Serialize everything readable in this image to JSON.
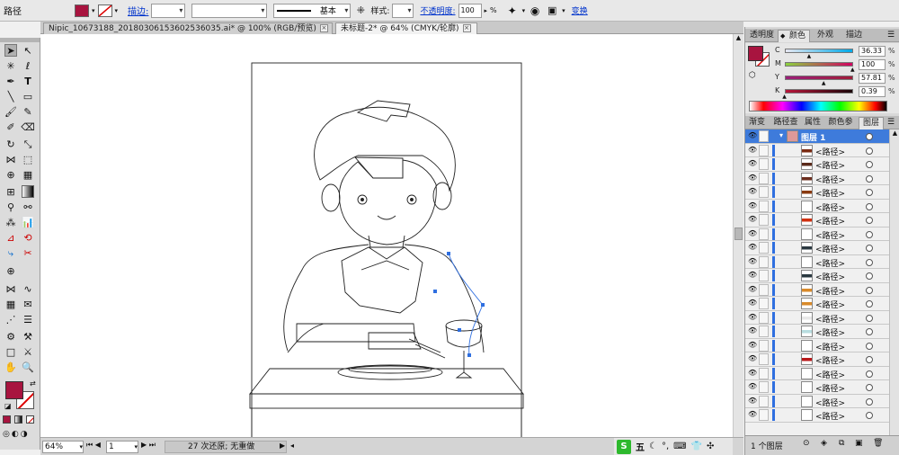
{
  "control_bar": {
    "object_type": "路径",
    "fill_color": "#a8143f",
    "stroke_label": "描边:",
    "stroke_weight": "",
    "brush_field": "",
    "stroke_profile": "基本",
    "style_label": "样式:",
    "opacity_label": "不透明度:",
    "opacity_value": "100",
    "opacity_unit": "%",
    "transform_label": "变换"
  },
  "doc_tabs": [
    {
      "title": "Nipic_10673188_20180306153602536035.ai* @ 100% (RGB/预览)",
      "active": false
    },
    {
      "title": "未标题-2* @ 64% (CMYK/轮廓)",
      "active": true
    }
  ],
  "status_bar": {
    "zoom": "64%",
    "artboard": "1",
    "history": "27 次还原; 无重做"
  },
  "ime_bar": {
    "mode": "五"
  },
  "color_panel": {
    "tabs": [
      "透明度",
      "颜色",
      "外观",
      "描边"
    ],
    "active_tab": "颜色",
    "fill_color": "#a8143f",
    "channels": [
      {
        "label": "C",
        "value": "36.33",
        "unit": "%",
        "gradient": "linear-gradient(90deg,#e6e6f0,#00a9e8)"
      },
      {
        "label": "M",
        "value": "100",
        "unit": "%",
        "gradient": "linear-gradient(90deg,#8bd23e,#d1005f)"
      },
      {
        "label": "Y",
        "value": "57.81",
        "unit": "%",
        "gradient": "linear-gradient(90deg,#9b1f79,#a11d3a)"
      },
      {
        "label": "K",
        "value": "0.39",
        "unit": "%",
        "gradient": "linear-gradient(90deg,#b8163a,#1a0508)"
      }
    ]
  },
  "layers_panel": {
    "tabs": [
      "渐变",
      "路径查",
      "属性",
      "颜色参",
      "图层"
    ],
    "active_tab": "图层",
    "top_layer": "图层 1",
    "sublayers": [
      {
        "name": "<路径>",
        "thumb": "#7a2a12"
      },
      {
        "name": "<路径>",
        "thumb": "#5a2a1a"
      },
      {
        "name": "<路径>",
        "thumb": "#6b2e1e"
      },
      {
        "name": "<路径>",
        "thumb": "#8a3a10"
      },
      {
        "name": "<路径>",
        "thumb": "#ffffff"
      },
      {
        "name": "<路径>",
        "thumb": "#d03010"
      },
      {
        "name": "<路径>",
        "thumb": "#ffffff"
      },
      {
        "name": "<路径>",
        "thumb": "#2a3840"
      },
      {
        "name": "<路径>",
        "thumb": "#ffffff"
      },
      {
        "name": "<路径>",
        "thumb": "#2a3840"
      },
      {
        "name": "<路径>",
        "thumb": "#d98a2a"
      },
      {
        "name": "<路径>",
        "thumb": "#d98a2a"
      },
      {
        "name": "<路径>",
        "thumb": "#e8e8e8"
      },
      {
        "name": "<路径>",
        "thumb": "#b8dde0"
      },
      {
        "name": "<路径>",
        "thumb": "#ffffff"
      },
      {
        "name": "<路径>",
        "thumb": "#b8181a"
      },
      {
        "name": "<路径>",
        "thumb": "#ffffff"
      },
      {
        "name": "<路径>",
        "thumb": "#ffffff"
      },
      {
        "name": "<路径>",
        "thumb": "#ffffff"
      },
      {
        "name": "<路径>",
        "thumb": "#ffffff"
      }
    ],
    "footer_count": "1 个图层"
  }
}
